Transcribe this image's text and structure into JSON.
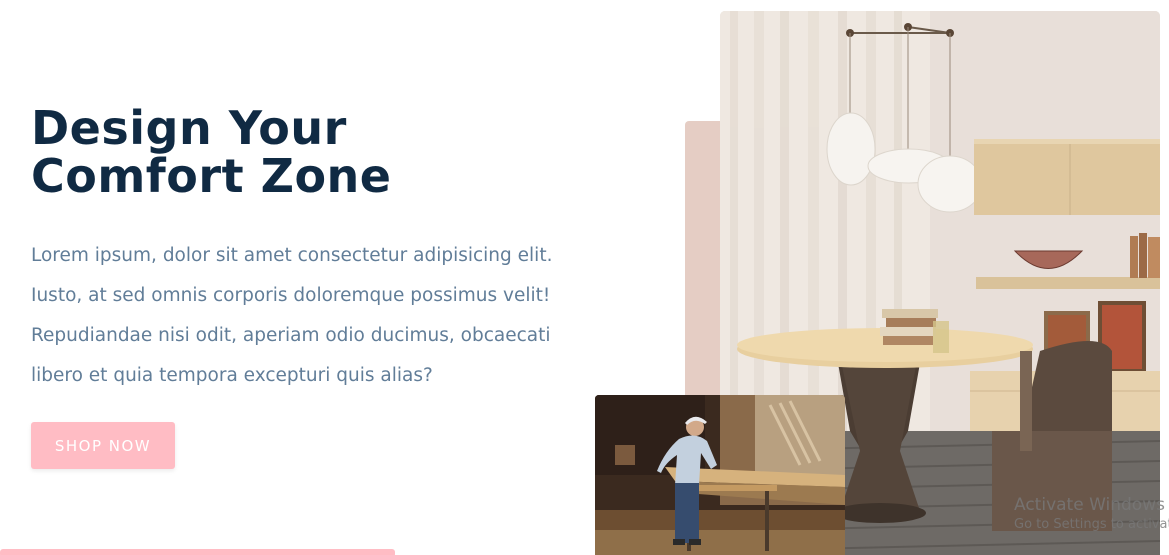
{
  "hero": {
    "title_line1": "Design Your",
    "title_line2": "Comfort Zone",
    "paragraph_lines": [
      "Lorem ipsum, dolor sit amet consectetur adipisicing elit.",
      "Iusto, at sed omnis corporis doloremque possimus velit!",
      "Repudiandae nisi odit, aperiam odio ducimus, obcaecati",
      "libero et quia tempora excepturi quis alias?"
    ],
    "cta_label": "SHOP NOW"
  },
  "watermark": {
    "title": "Activate Windows",
    "subtitle": "Go to Settings to activate Windows."
  },
  "colors": {
    "heading": "#102a43",
    "body_text": "#617d98",
    "accent_pink": "#ffbcc4",
    "accent_beige": "#e5cdc4"
  },
  "images": {
    "main": "interior-dining-room-photo",
    "secondary": "carpenter-workshop-photo"
  }
}
